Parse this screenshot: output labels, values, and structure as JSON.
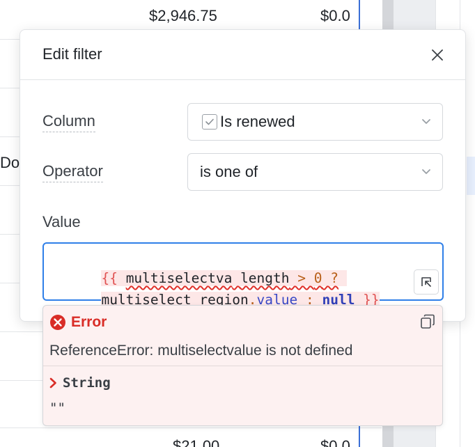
{
  "background_table": {
    "top_amount": "$2,946.75",
    "top_amount_2": "$0.0",
    "left_partial_text": "Do",
    "bottom_amount": "$21.00",
    "bottom_amount_2": "$0.0"
  },
  "modal": {
    "title": "Edit filter",
    "column": {
      "label": "Column",
      "value": "Is renewed",
      "icon": "checkbox-icon"
    },
    "operator": {
      "label": "Operator",
      "value": "is one of"
    },
    "value": {
      "label": "Value",
      "code": {
        "line1": [
          {
            "text": "{{ ",
            "type": "brace"
          },
          {
            "text": "multiselectva",
            "type": "ident"
          },
          {
            "text": " ",
            "type": "ident"
          },
          {
            "text": "length",
            "type": "ident"
          },
          {
            "text": " > ",
            "type": "op"
          },
          {
            "text": "0",
            "type": "num"
          },
          {
            "text": " ?",
            "type": "op"
          }
        ],
        "line2": [
          {
            "text": "multiselect_region",
            "type": "ident"
          },
          {
            "text": ".",
            "type": "op"
          },
          {
            "text": "value",
            "type": "prop"
          },
          {
            "text": " : ",
            "type": "op"
          },
          {
            "text": "null",
            "type": "kw"
          },
          {
            "text": " }}",
            "type": "brace"
          }
        ]
      }
    }
  },
  "error": {
    "title": "Error",
    "message": "ReferenceError: multiselectvalue is not defined",
    "type_label": "String",
    "value": "\"\""
  },
  "colors": {
    "accent_blue": "#2f7fe8",
    "error_red": "#d92d27",
    "error_bg": "#fdf1f1"
  }
}
